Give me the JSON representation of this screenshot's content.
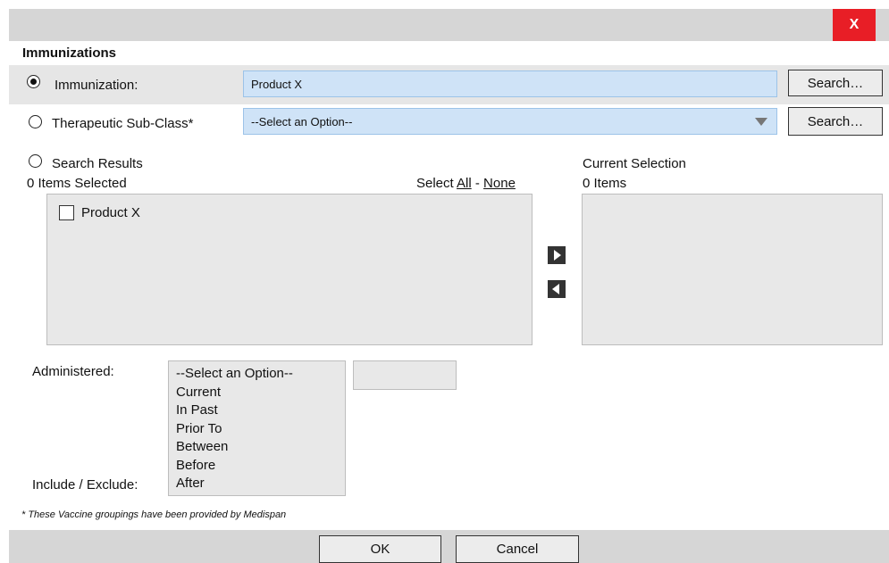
{
  "dialog": {
    "close_label": "X",
    "section_title": "Immunizations"
  },
  "immunization": {
    "label": "Immunization:",
    "value": "Product X",
    "search_label": "Search…",
    "selected": true
  },
  "therapeutic": {
    "label": "Therapeutic Sub-Class*",
    "selected_option": "--Select an Option--",
    "search_label": "Search…"
  },
  "search_results": {
    "label": "Search Results",
    "count_text": "0 Items Selected",
    "select_prefix": "Select ",
    "select_all": "All",
    "select_sep": " - ",
    "select_none": "None",
    "items": [
      {
        "label": "Product X",
        "checked": false
      }
    ]
  },
  "current_selection": {
    "label": "Current Selection",
    "count_text": "0 Items"
  },
  "filters": {
    "administered_label": "Administered:",
    "include_label": "Include / Exclude:",
    "options": [
      "--Select an Option--",
      "Current",
      "In Past",
      "Prior To",
      "Between",
      "Before",
      "After"
    ]
  },
  "footnote": "* These Vaccine groupings have been provided by Medispan",
  "footer": {
    "ok_label": "OK",
    "cancel_label": "Cancel"
  },
  "colors": {
    "close_bg": "#e81e26",
    "input_bg": "#cfe3f7",
    "bar_bg": "#d6d6d6"
  }
}
